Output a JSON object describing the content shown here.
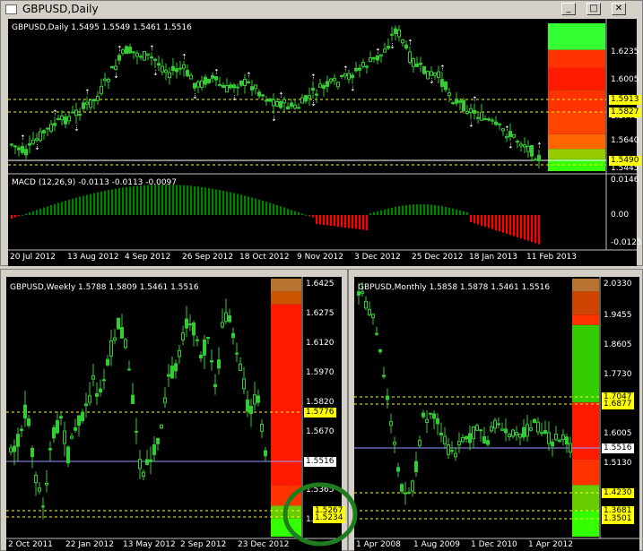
{
  "daily": {
    "window_title": "GBPUSD,Daily",
    "header": "GBPUSD,Daily  1.5495 1.5549 1.5461 1.5516",
    "indicator": "MACD (12,26,9) -0.0113 -0.0113 -0.0097",
    "price_ticks": [
      "1.6235",
      "1.6005",
      "1.5775",
      "1.5640",
      "1.5445"
    ],
    "macd_ticks": [
      "0.0146",
      "0.00",
      "-0.0125"
    ],
    "levels": [
      "1.5913",
      "1.5827"
    ],
    "current": "1.5490",
    "dates": [
      "20 Jul 2012",
      "13 Aug 2012",
      "4 Sep 2012",
      "26 Sep 2012",
      "18 Oct 2012",
      "9 Nov 2012",
      "3 Dec 2012",
      "25 Dec 2012",
      "18 Jan 2013",
      "11 Feb 2013"
    ]
  },
  "weekly": {
    "header": "GBPUSD,Weekly  1.5788 1.5809 1.5461 1.5516",
    "price_ticks": [
      "1.6425",
      "1.6275",
      "1.6120",
      "1.5970",
      "1.5820",
      "1.5670",
      "1.5365",
      "1.5210"
    ],
    "levels": [
      "1.5776",
      "1.5267",
      "1.5234"
    ],
    "current": "1.5516",
    "dates": [
      "2 Oct 2011",
      "22 Jan 2012",
      "13 May 2012",
      "2 Sep 2012",
      "23 Dec 2012"
    ]
  },
  "monthly": {
    "header": "GBPUSD,Monthly  1.5858 1.5878 1.5461 1.5516",
    "price_ticks": [
      "2.0330",
      "1.9455",
      "1.8605",
      "1.7730",
      "1.6005",
      "1.5130"
    ],
    "levels": [
      "1.7047",
      "1.6877",
      "1.4230",
      "1.3681",
      "1.3501"
    ],
    "current": "1.5516",
    "dates": [
      "1 Apr 2008",
      "1 Aug 2009",
      "1 Dec 2010",
      "1 Apr 2012"
    ]
  },
  "colors": {
    "bull": "#32cd32",
    "macd_pos": "#008000",
    "macd_neg": "#ff0000",
    "level": "#ffff00",
    "annotation": "#1e7d1e"
  }
}
